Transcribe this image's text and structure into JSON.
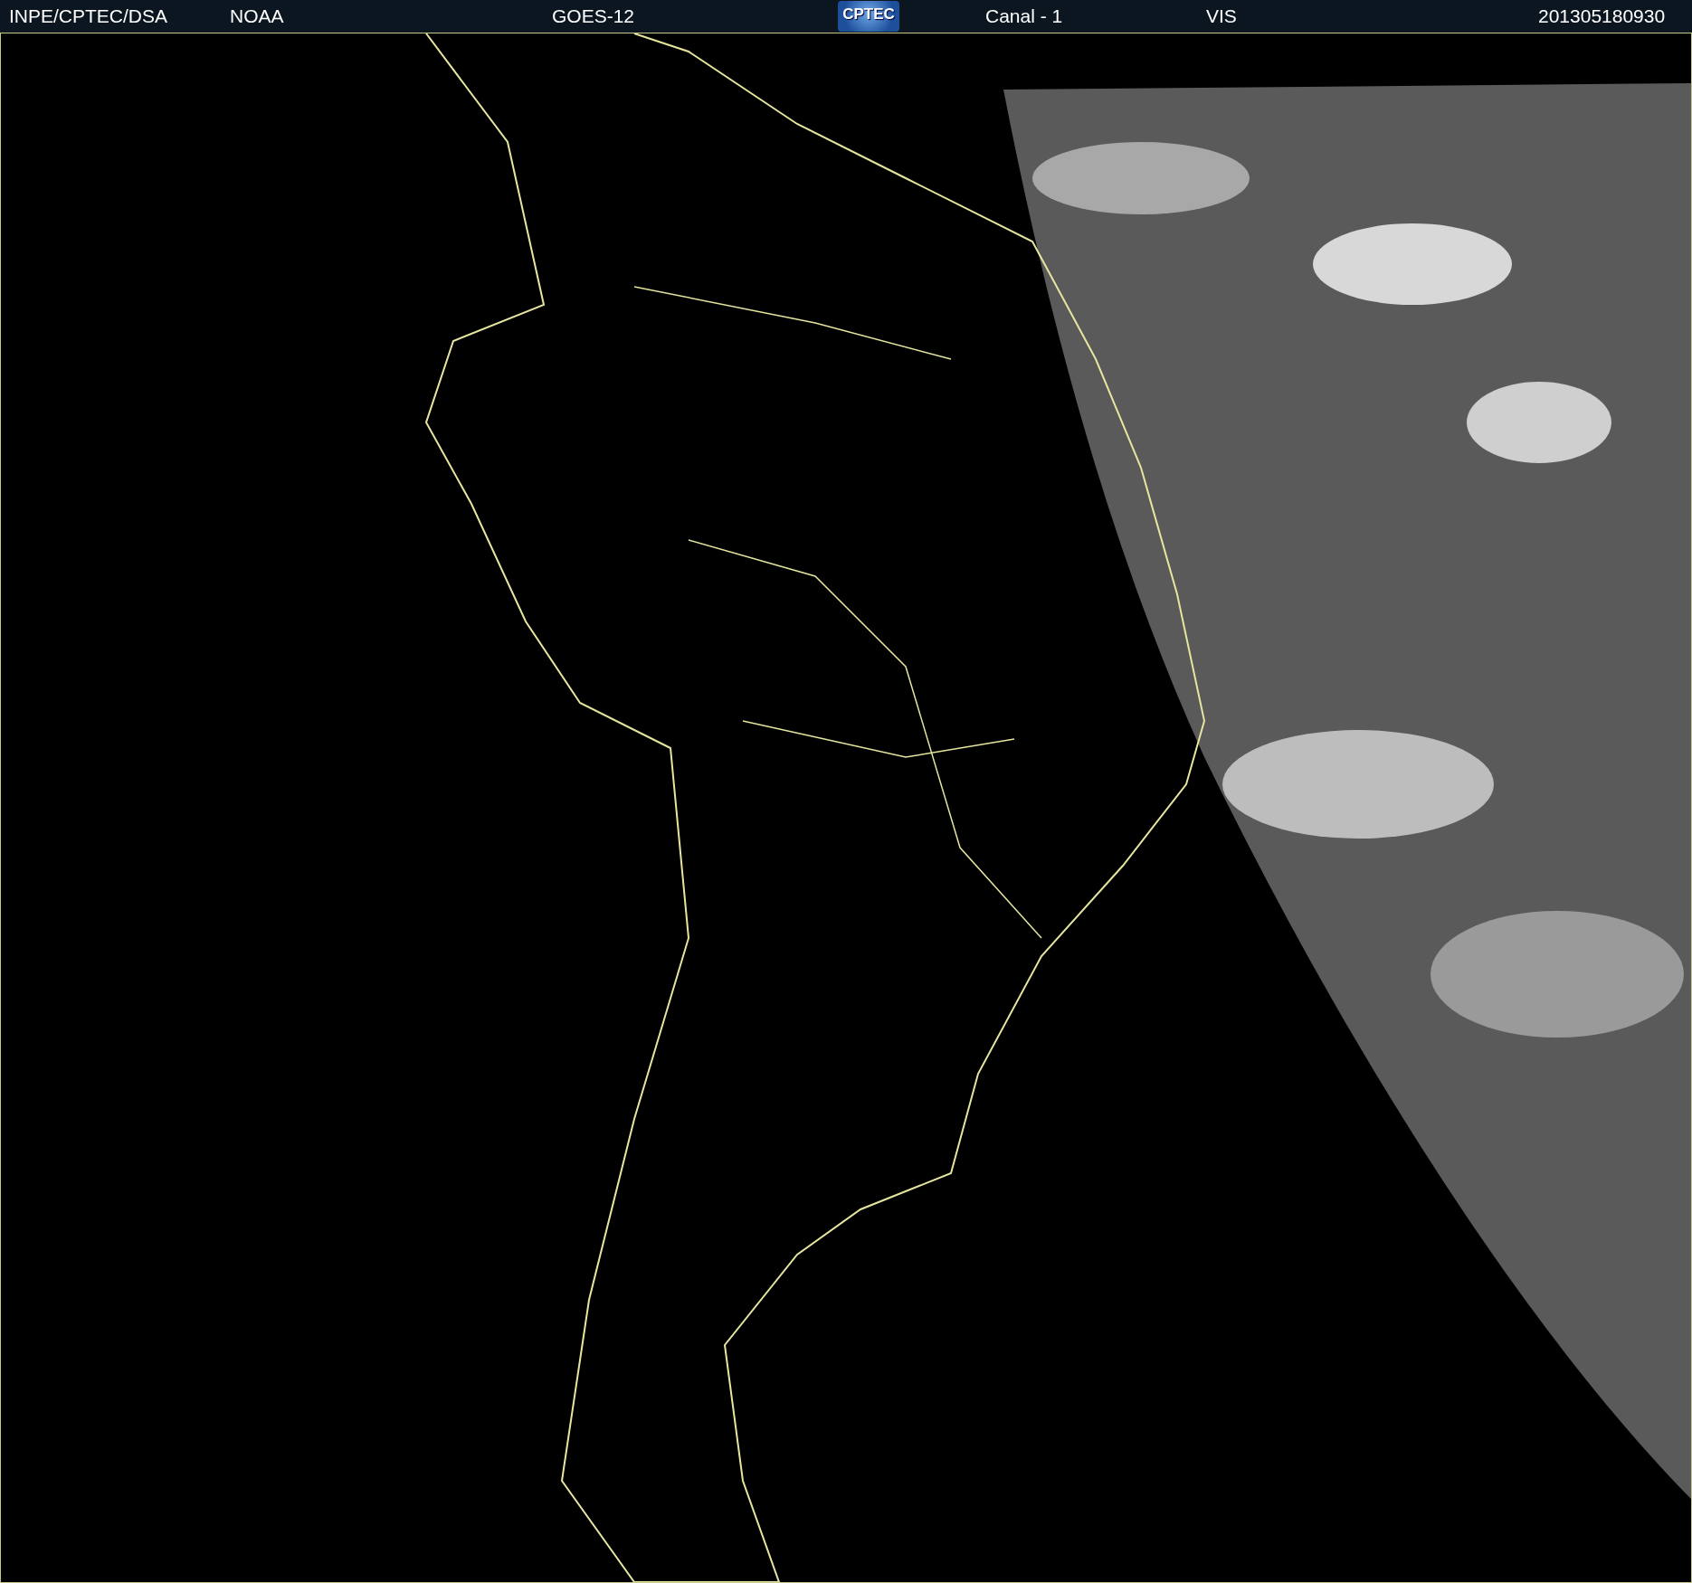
{
  "header": {
    "items": [
      {
        "kind": "text",
        "text": "INPE/CPTEC/DSA"
      },
      {
        "kind": "text",
        "text": "NOAA"
      },
      {
        "kind": "text",
        "text": "GOES-12"
      },
      {
        "kind": "logo",
        "text": "CPTEC"
      },
      {
        "kind": "text",
        "text": "Canal - 1"
      },
      {
        "kind": "text",
        "text": "VIS"
      },
      {
        "kind": "text",
        "text": "201305180930"
      }
    ]
  }
}
